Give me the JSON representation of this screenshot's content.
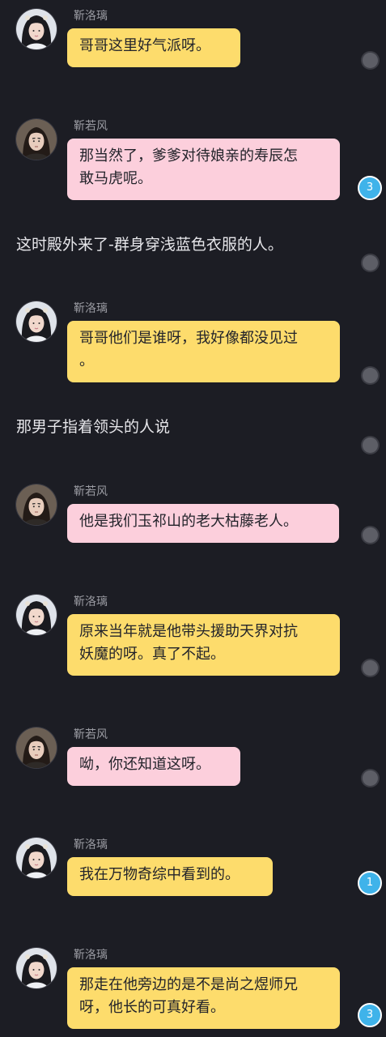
{
  "feed": [
    {
      "kind": "message",
      "speaker": "靳洛璃",
      "avatar_icon": "female-character-avatar-icon",
      "color": "yellow",
      "text": "哥哥这里好气派呀。",
      "indicator": "dot"
    },
    {
      "kind": "message",
      "speaker": "靳若风",
      "avatar_icon": "male-character-avatar-icon",
      "color": "pink",
      "text": "那当然了，爹爹对待娘亲的寿辰怎\n敢马虎呢。",
      "indicator": "3"
    },
    {
      "kind": "narration",
      "text": "这时殿外来了-群身穿浅蓝色衣服的人。",
      "indicator": "dot"
    },
    {
      "kind": "message",
      "speaker": "靳洛璃",
      "avatar_icon": "female-character-avatar-icon",
      "color": "yellow",
      "text": "哥哥他们是谁呀，我好像都没见过\n。",
      "indicator": "dot"
    },
    {
      "kind": "narration",
      "text": "那男子指着领头的人说",
      "indicator": "dot"
    },
    {
      "kind": "message",
      "speaker": "靳若风",
      "avatar_icon": "male-character-avatar-icon",
      "color": "pink",
      "text": "他是我们玉祁山的老大枯藤老人。",
      "indicator": "dot"
    },
    {
      "kind": "message",
      "speaker": "靳洛璃",
      "avatar_icon": "female-character-avatar-icon",
      "color": "yellow",
      "text": "原来当年就是他带头援助天界对抗\n妖魔的呀。真了不起。",
      "indicator": "dot"
    },
    {
      "kind": "message",
      "speaker": "靳若风",
      "avatar_icon": "male-character-avatar-icon",
      "color": "pink",
      "text": "呦，你还知道这呀。",
      "indicator": "dot"
    },
    {
      "kind": "message",
      "speaker": "靳洛璃",
      "avatar_icon": "female-character-avatar-icon",
      "color": "yellow",
      "text": "我在万物奇综中看到的。",
      "indicator": "1"
    },
    {
      "kind": "message",
      "speaker": "靳洛璃",
      "avatar_icon": "female-character-avatar-icon",
      "color": "yellow",
      "text": "那走在他旁边的是不是尚之煜师兄\n呀，他长的可真好看。",
      "indicator": "3"
    }
  ]
}
